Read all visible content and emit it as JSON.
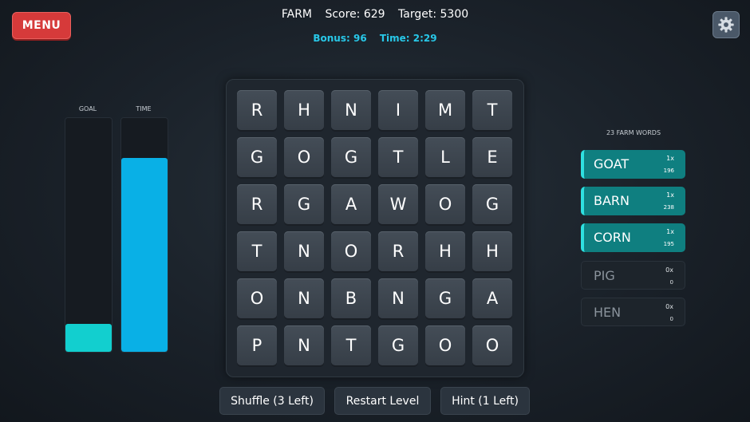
{
  "menu_label": "MENU",
  "header": {
    "category": "FARM",
    "score": "Score: 629",
    "target": "Target: 5300"
  },
  "subheader": {
    "bonus": "Bonus: 96",
    "time": "Time: 2:29"
  },
  "settings_icon": "gear-icon",
  "meters": {
    "goal": {
      "label": "GOAL",
      "fill_fraction": 0.12,
      "color": "#12cfcf"
    },
    "time": {
      "label": "TIME",
      "fill_fraction": 0.83,
      "color": "#09b0e6"
    }
  },
  "grid": [
    [
      "R",
      "H",
      "N",
      "I",
      "M",
      "T"
    ],
    [
      "G",
      "O",
      "G",
      "T",
      "L",
      "E"
    ],
    [
      "R",
      "G",
      "A",
      "W",
      "O",
      "G"
    ],
    [
      "T",
      "N",
      "O",
      "R",
      "H",
      "H"
    ],
    [
      "O",
      "N",
      "B",
      "N",
      "G",
      "A"
    ],
    [
      "P",
      "N",
      "T",
      "G",
      "O",
      "O"
    ]
  ],
  "word_list": {
    "title": "23 FARM WORDS",
    "items": [
      {
        "word": "GOAT",
        "multiplier": "1x",
        "points": "196",
        "found": true
      },
      {
        "word": "BARN",
        "multiplier": "1x",
        "points": "238",
        "found": true
      },
      {
        "word": "CORN",
        "multiplier": "1x",
        "points": "195",
        "found": true
      },
      {
        "word": "PIG",
        "multiplier": "0x",
        "points": "0",
        "found": false
      },
      {
        "word": "HEN",
        "multiplier": "0x",
        "points": "0",
        "found": false
      }
    ]
  },
  "buttons": {
    "shuffle": "Shuffle (3 Left)",
    "restart": "Restart Level",
    "hint": "Hint (1 Left)"
  },
  "colors": {
    "menu_red": "#d63a3a",
    "accent_cyan": "#28c8e8",
    "found_teal": "#0f7f80"
  }
}
